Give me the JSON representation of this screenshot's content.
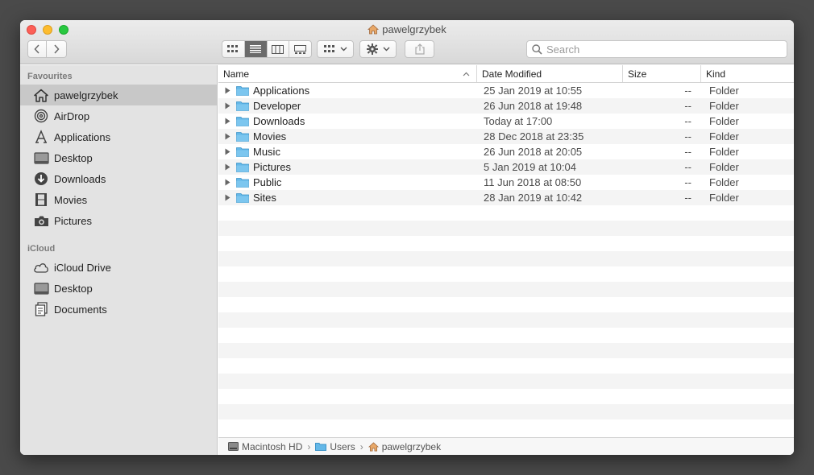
{
  "window": {
    "title": "pawelgrzybek",
    "colors": {
      "accent_folder": "#64b8e8",
      "selected_row": "#c8c8c8"
    }
  },
  "toolbar": {
    "back_label": "<",
    "forward_label": ">",
    "views": [
      "icon-view",
      "list-view",
      "column-view",
      "gallery-view"
    ],
    "active_view": "list-view"
  },
  "search": {
    "placeholder": "Search",
    "value": ""
  },
  "sidebar": {
    "sections": [
      {
        "title": "Favourites",
        "items": [
          {
            "label": "pawelgrzybek",
            "icon": "home-icon",
            "selected": true
          },
          {
            "label": "AirDrop",
            "icon": "airdrop-icon"
          },
          {
            "label": "Applications",
            "icon": "applications-icon"
          },
          {
            "label": "Desktop",
            "icon": "desktop-icon"
          },
          {
            "label": "Downloads",
            "icon": "downloads-icon"
          },
          {
            "label": "Movies",
            "icon": "movies-icon"
          },
          {
            "label": "Pictures",
            "icon": "pictures-icon"
          }
        ]
      },
      {
        "title": "iCloud",
        "items": [
          {
            "label": "iCloud Drive",
            "icon": "cloud-icon"
          },
          {
            "label": "Desktop",
            "icon": "desktop-icon"
          },
          {
            "label": "Documents",
            "icon": "documents-icon"
          }
        ]
      }
    ]
  },
  "list": {
    "columns": {
      "name": "Name",
      "date": "Date Modified",
      "size": "Size",
      "kind": "Kind"
    },
    "rows": [
      {
        "name": "Applications",
        "date": "25 Jan 2019 at 10:55",
        "size": "--",
        "kind": "Folder"
      },
      {
        "name": "Developer",
        "date": "26 Jun 2018 at 19:48",
        "size": "--",
        "kind": "Folder"
      },
      {
        "name": "Downloads",
        "date": "Today at 17:00",
        "size": "--",
        "kind": "Folder"
      },
      {
        "name": "Movies",
        "date": "28 Dec 2018 at 23:35",
        "size": "--",
        "kind": "Folder"
      },
      {
        "name": "Music",
        "date": "26 Jun 2018 at 20:05",
        "size": "--",
        "kind": "Folder"
      },
      {
        "name": "Pictures",
        "date": "5 Jan 2019 at 10:04",
        "size": "--",
        "kind": "Folder"
      },
      {
        "name": "Public",
        "date": "11 Jun 2018 at 08:50",
        "size": "--",
        "kind": "Folder"
      },
      {
        "name": "Sites",
        "date": "28 Jan 2019 at 10:42",
        "size": "--",
        "kind": "Folder"
      }
    ]
  },
  "pathbar": {
    "segments": [
      "Macintosh HD",
      "Users",
      "pawelgrzybek"
    ]
  }
}
